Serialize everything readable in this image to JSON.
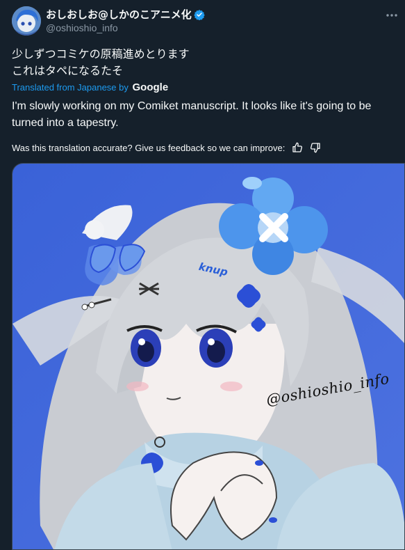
{
  "author": {
    "display_name": "おしおしお@しかのこアニメ化",
    "handle": "@oshioshio_info",
    "verified": true
  },
  "tweet": {
    "original_text": "少しずつコミケの原稿進めとります\nこれはタペになるたそ",
    "translated_by_prefix": "Translated from Japanese by",
    "translated_by_brand": "Google",
    "translated_text": "I'm slowly working on my Comiket manuscript. It looks like it's going to be turned into a tapestry.",
    "feedback_prompt": "Was this translation accurate? Give us feedback so we can improve:"
  },
  "media": {
    "hair_text": "knup",
    "watermark": "@oshioshio_info"
  },
  "icons": {
    "verified": "verified-badge-icon",
    "more": "more-icon",
    "thumbs_up": "thumbs-up-icon",
    "thumbs_down": "thumbs-down-icon"
  },
  "colors": {
    "background": "#15202b",
    "accent": "#1d9bf0",
    "secondary_text": "#8b98a5",
    "illustration_blue": "#3b63d8"
  }
}
